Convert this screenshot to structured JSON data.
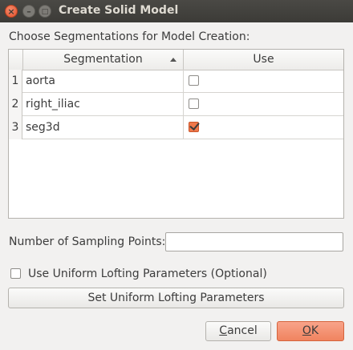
{
  "window": {
    "title": "Create Solid Model",
    "controls": {
      "close": "×",
      "minimize": "–",
      "maximize": "□"
    }
  },
  "main": {
    "choose_label": "Choose Segmentations for Model Creation:",
    "table": {
      "headers": {
        "segmentation": "Segmentation",
        "use": "Use"
      },
      "rows": [
        {
          "num": "1",
          "name": "aorta",
          "use": false
        },
        {
          "num": "2",
          "name": "right_iliac",
          "use": false
        },
        {
          "num": "3",
          "name": "seg3d",
          "use": true
        }
      ]
    },
    "sampling_label": "Number of Sampling Points:",
    "sampling_value": "",
    "uniform_label": "Use Uniform Lofting Parameters (Optional)",
    "uniform_checked": false,
    "set_uniform_button": "Set Uniform Lofting Parameters"
  },
  "buttons": {
    "cancel_mnemonic": "C",
    "cancel_rest": "ancel",
    "ok_mnemonic": "O",
    "ok_rest": "K"
  },
  "colors": {
    "accent": "#f0784a",
    "titlebar": "#3c3b37"
  }
}
